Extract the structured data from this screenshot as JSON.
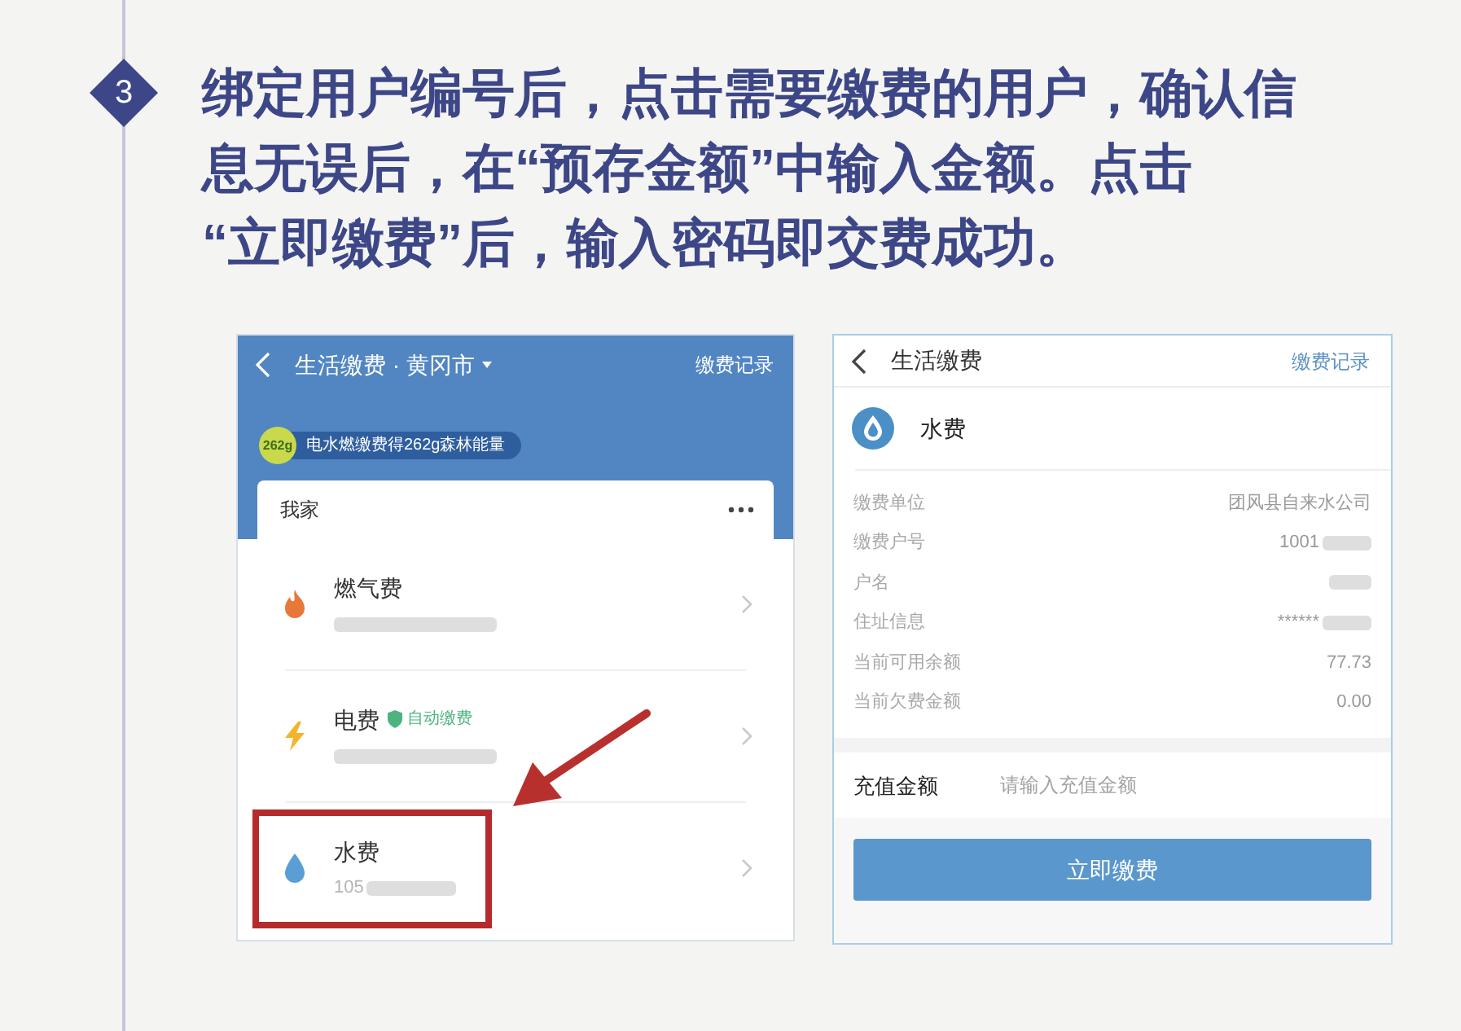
{
  "step": {
    "number": "3"
  },
  "instruction": {
    "lines": [
      "绑定用户编号后，点击需要缴费的用户，确认信",
      "息无误后，在“预存金额”中输入金额。点击",
      "“立即缴费”后，输入密码即交费成功。"
    ]
  },
  "left_screen": {
    "header": {
      "title": "生活缴费 · 黄冈市",
      "action": "缴费记录"
    },
    "energy_badge": {
      "value": "262g",
      "text": "电水燃缴费得262g森林能量"
    },
    "group": {
      "title": "我家"
    },
    "bills": [
      {
        "kind": "gas",
        "title": "燃气费",
        "account_redacted": true,
        "highlighted": false
      },
      {
        "kind": "electricity",
        "title": "电费",
        "tag": "自动缴费",
        "account_redacted": true,
        "highlighted": false
      },
      {
        "kind": "water",
        "title": "水费",
        "account_prefix": "105",
        "account_redacted": true,
        "highlighted": true
      }
    ]
  },
  "right_screen": {
    "header": {
      "title": "生活缴费",
      "action": "缴费记录"
    },
    "bill": {
      "kind": "water",
      "title": "水费"
    },
    "details": [
      {
        "label": "缴费单位",
        "value": "团风县自来水公司",
        "redacted": false
      },
      {
        "label": "缴费户号",
        "value": "1001",
        "redacted": true
      },
      {
        "label": "户名",
        "redacted": true
      },
      {
        "label": "住址信息",
        "value": "******",
        "redacted": true
      },
      {
        "label": "当前可用余额",
        "value": "77.73",
        "redacted": false
      },
      {
        "label": "当前欠费金额",
        "value": "0.00",
        "redacted": false
      }
    ],
    "amount_field": {
      "label": "充值金额",
      "placeholder": "请输入充值金额"
    },
    "submit_button": {
      "label": "立即缴费"
    }
  }
}
